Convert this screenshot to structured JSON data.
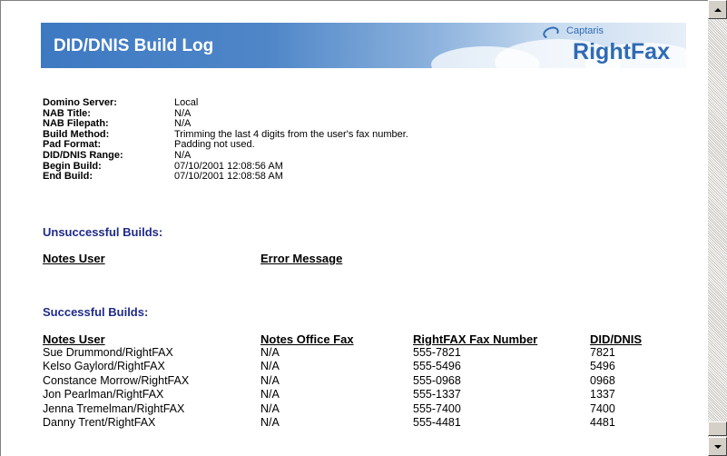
{
  "banner": {
    "title": "DID/DNIS Build Log",
    "logo_top": "Captaris",
    "logo_main": "RightFax"
  },
  "info": [
    {
      "key": "Domino Server:",
      "value": "Local"
    },
    {
      "key": "NAB Title:",
      "value": "N/A"
    },
    {
      "key": "NAB Filepath:",
      "value": "N/A"
    },
    {
      "key": "Build Method:",
      "value": "Trimming the last 4 digits from the user's fax number."
    },
    {
      "key": "Pad Format:",
      "value": "Padding not used."
    },
    {
      "key": "DID/DNIS Range:",
      "value": "N/A"
    },
    {
      "key": "Begin Build:",
      "value": "07/10/2001 12:08:56 AM"
    },
    {
      "key": "End Build:",
      "value": "07/10/2001 12:08:58 AM"
    }
  ],
  "unsuccessful": {
    "title": "Unsuccessful Builds:",
    "headers": [
      "Notes User",
      "Error Message"
    ]
  },
  "successful": {
    "title": "Successful Builds:",
    "headers": [
      "Notes User",
      "Notes Office Fax",
      "RightFAX Fax Number",
      "DID/DNIS"
    ],
    "rows": [
      [
        "Sue Drummond/RightFAX",
        "N/A",
        "555-7821",
        "7821"
      ],
      [
        "Kelso Gaylord/RightFAX",
        "N/A",
        "555-5496",
        "5496"
      ],
      [
        "Constance Morrow/RightFAX",
        "N/A",
        "555-0968",
        "0968"
      ],
      [
        "Jon Pearlman/RightFAX",
        "N/A",
        "555-1337",
        "1337"
      ],
      [
        "Jenna Tremelman/RightFAX",
        "N/A",
        "555-7400",
        "7400"
      ],
      [
        "Danny Trent/RightFAX",
        "N/A",
        "555-4481",
        "4481"
      ]
    ]
  },
  "colors": {
    "banner_blue": "#3d79c2",
    "section_title": "#1f2a8a",
    "logo_blue": "#2f6bb5"
  },
  "icons": {
    "scroll_up": "arrow-up-icon",
    "scroll_down": "arrow-down-icon"
  }
}
